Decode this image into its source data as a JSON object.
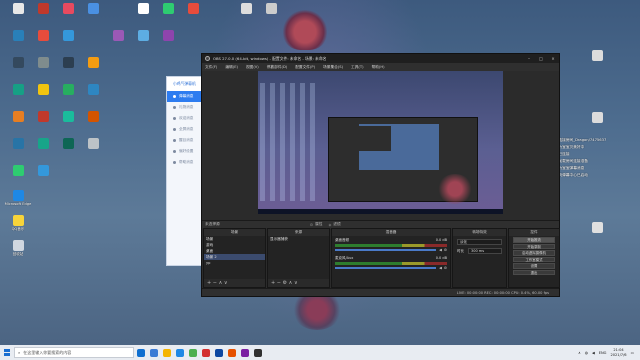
{
  "desktop_icons": [
    {
      "label": "",
      "color": "#e8e8e8"
    },
    {
      "label": "",
      "color": "#c0392b"
    },
    {
      "label": "",
      "color": "#e84a5f"
    },
    {
      "label": "",
      "color": "#4a90e2"
    },
    {
      "label": "",
      "color": "#ffffff"
    },
    {
      "label": "",
      "color": "#2ecc71"
    },
    {
      "label": "",
      "color": "#e74c3c"
    },
    {
      "label": "",
      "color": "#dddddd"
    },
    {
      "label": "",
      "color": "#cccccc"
    },
    {
      "label": "",
      "color": "#2980b9"
    },
    {
      "label": "",
      "color": "#e74c3c"
    },
    {
      "label": "",
      "color": "#3498db"
    },
    {
      "label": "",
      "color": "#9b59b6"
    },
    {
      "label": "",
      "color": "#5dade2"
    },
    {
      "label": "",
      "color": "#8e44ad"
    },
    {
      "label": "",
      "color": "#34495e"
    },
    {
      "label": "",
      "color": "#7f8c8d"
    },
    {
      "label": "",
      "color": "#2c3e50"
    },
    {
      "label": "",
      "color": "#f39c12"
    },
    {
      "label": "",
      "color": "#16a085"
    },
    {
      "label": "",
      "color": "#f1c40f"
    },
    {
      "label": "",
      "color": "#27ae60"
    },
    {
      "label": "",
      "color": "#2e86c1"
    },
    {
      "label": "",
      "color": "#e67e22"
    },
    {
      "label": "",
      "color": "#c0392b"
    },
    {
      "label": "",
      "color": "#1abc9c"
    },
    {
      "label": "",
      "color": "#d35400"
    },
    {
      "label": "",
      "color": "#2874a6"
    },
    {
      "label": "",
      "color": "#17a589"
    },
    {
      "label": "",
      "color": "#0e6655"
    },
    {
      "label": "",
      "color": "#bdc3c7"
    },
    {
      "label": "",
      "color": "#2ecc71"
    },
    {
      "label": "",
      "color": "#3498db"
    },
    {
      "label": "Microsoft Edge",
      "color": "#1e88e5"
    },
    {
      "label": "QQ音乐",
      "color": "#f7d43a"
    },
    {
      "label": "回收站",
      "color": "#d0d7e0"
    }
  ],
  "right_icons": [
    {
      "label": "",
      "color": "#dcdcdc"
    },
    {
      "label": "",
      "color": "#dcdcdc"
    },
    {
      "label": "",
      "color": "#e0e0e0"
    }
  ],
  "chat": {
    "lines": [
      "[小圆气] 正在连接房间_Dragon/7475637",
      "[小圆气] 正在为宝宝贝美好中",
      "[小圆气] 房间已连接",
      "[小圆气] 正在加载房间连接准备",
      "[小圆气] 正在为宝宝弹幕消息",
      "[小圆气] 当前页弹幕中心已启动"
    ]
  },
  "app": {
    "title": "小鸡气弹幕机",
    "items": [
      "弹幕消息",
      "礼物消息",
      "欢迎消息",
      "全屏消息",
      "醒目消息",
      "偏好设置",
      "帮助消息"
    ]
  },
  "obs": {
    "title": "OBS 27.0.0 (64-bit, windows) - 配置文件: 未命名 - 场景: 未命名",
    "menu": [
      "文件(F)",
      "编辑(E)",
      "视图(V)",
      "停靠部件(D)",
      "配置文件(P)",
      "场景集合(S)",
      "工具(T)",
      "帮助(H)"
    ],
    "source_bar": "未选择源",
    "props_btn": "属性",
    "filters_btn": "滤镜",
    "docks": {
      "scenes": {
        "title": "场景",
        "items": [
          "场景",
          "游戏",
          "桌面",
          "场景 2",
          "yp"
        ],
        "selected": 3
      },
      "sources": {
        "title": "来源",
        "items": [
          "显示器捕获"
        ]
      },
      "mixer": {
        "title": "混音器",
        "channels": [
          {
            "name": "桌面音频",
            "db": "0.0 dB"
          },
          {
            "name": "麦克风/Aux",
            "db": "0.0 dB"
          }
        ]
      },
      "transitions": {
        "title": "转场特效",
        "type": "淡化",
        "duration_label": "时长",
        "duration": "300 ms"
      },
      "controls": {
        "title": "控件",
        "buttons": [
          "开始推流",
          "开始录制",
          "启动虚拟摄像机",
          "工作室模式",
          "设置",
          "退出"
        ]
      }
    },
    "status": "LIVE: 00:00:00   REC: 00:00:00   CPU: 0.4%, 60.00 fps"
  },
  "taskbar": {
    "search_placeholder": "在这里输入你要搜索的内容",
    "apps": [
      {
        "color": "#0f6fd0"
      },
      {
        "color": "#3a7bd5"
      },
      {
        "color": "#f4b400"
      },
      {
        "color": "#1e88e5"
      },
      {
        "color": "#4caf50"
      },
      {
        "color": "#d32f2f"
      },
      {
        "color": "#0d47a1"
      },
      {
        "color": "#e65100"
      },
      {
        "color": "#7b1fa2"
      },
      {
        "color": "#303030"
      }
    ],
    "ime": "ENG",
    "time": "21:04",
    "date": "2021/7/6"
  }
}
